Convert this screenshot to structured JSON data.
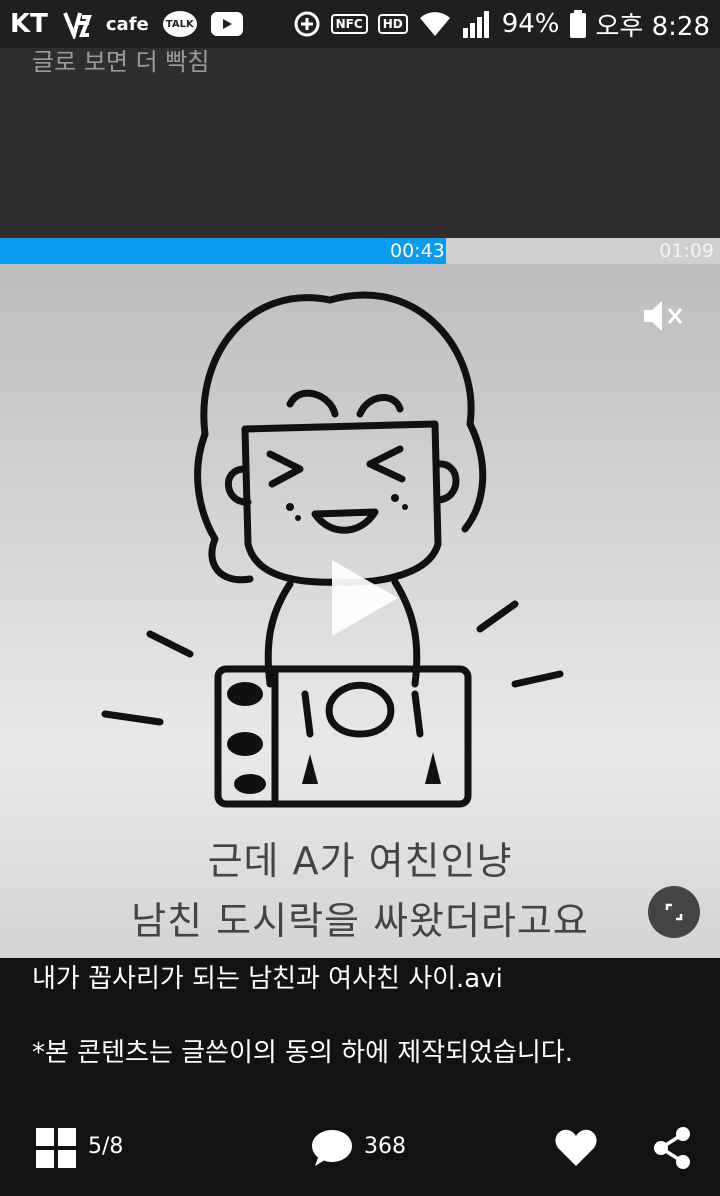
{
  "status_bar": {
    "carrier": "KT",
    "cafe": "cafe",
    "talk": "TALK",
    "nfc": "NFC",
    "hd": "HD",
    "battery": "94%",
    "time": "오후 8:28"
  },
  "top_caption": "글로 보면 더 빡침",
  "player": {
    "current_time": "00:43",
    "total_time": "01:09",
    "progress_fraction": 0.62,
    "subtitle_line1": "근데 A가 여친인냥",
    "subtitle_line2": "남친 도시락을 싸왔더라고요",
    "muted": true
  },
  "post": {
    "title": "내가 꼽사리가 되는 남친과 여사친 사이.avi",
    "description": "*본 콘텐츠는 글쓴이의 동의 하에 제작되었습니다."
  },
  "bottom_bar": {
    "page_count": "5/8",
    "comment_count": "368"
  },
  "icons": [
    "mute-icon",
    "play-icon",
    "expand-icon",
    "grid-icon",
    "comment-icon",
    "heart-icon",
    "share-icon"
  ],
  "colors": {
    "progress": "#0a9bf0",
    "background": "#121212"
  }
}
